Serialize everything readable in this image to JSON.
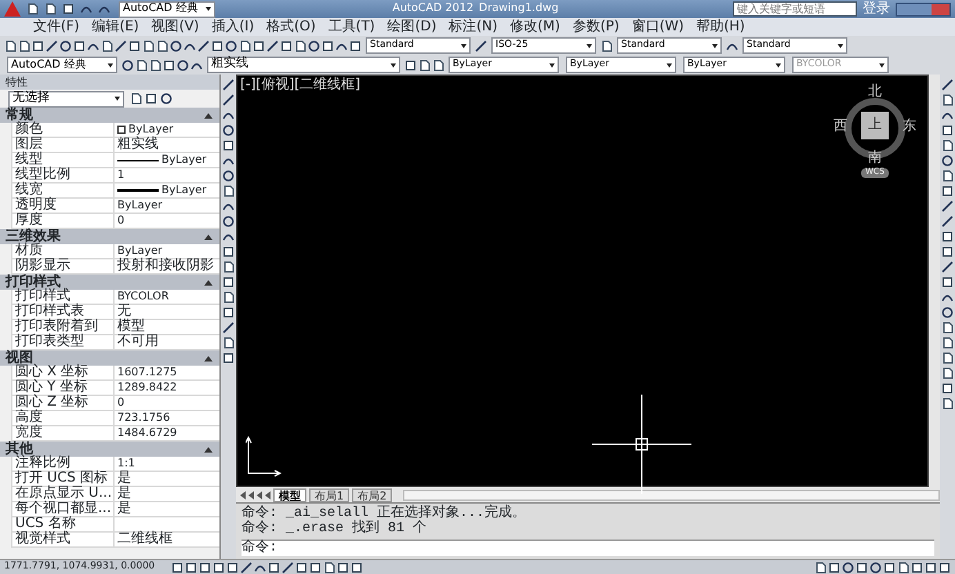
{
  "title_bar": {
    "workspace": "AutoCAD 经典",
    "app": "AutoCAD 2012",
    "file": "Drawing1.dwg",
    "search_placeholder": "键入关键字或短语",
    "login": "登录"
  },
  "menu": [
    "文件(F)",
    "编辑(E)",
    "视图(V)",
    "插入(I)",
    "格式(O)",
    "工具(T)",
    "绘图(D)",
    "标注(N)",
    "修改(M)",
    "参数(P)",
    "窗口(W)",
    "帮助(H)"
  ],
  "styles_toolbar": {
    "text_style": "Standard",
    "dim_style": "ISO-25",
    "table_style": "Standard",
    "mleader_style": "Standard"
  },
  "layers_toolbar": {
    "workspace": "AutoCAD 经典",
    "layer": "粗实线",
    "color_control": "ByLayer",
    "linetype": "ByLayer",
    "lineweight": "ByLayer",
    "plot_style": "BYCOLOR"
  },
  "properties": {
    "title": "特性",
    "selection": "无选择",
    "sections": [
      {
        "title": "常规",
        "expanded": true,
        "rows": [
          {
            "label": "颜色",
            "value": "ByLayer",
            "kind": "color"
          },
          {
            "label": "图层",
            "value": "粗实线",
            "kind": "text"
          },
          {
            "label": "线型",
            "value": "ByLayer",
            "kind": "line"
          },
          {
            "label": "线型比例",
            "value": "1",
            "kind": "text"
          },
          {
            "label": "线宽",
            "value": "ByLayer",
            "kind": "thickline"
          },
          {
            "label": "透明度",
            "value": "ByLayer",
            "kind": "text"
          },
          {
            "label": "厚度",
            "value": "0",
            "kind": "text"
          }
        ]
      },
      {
        "title": "三维效果",
        "expanded": true,
        "rows": [
          {
            "label": "材质",
            "value": "ByLayer",
            "kind": "text"
          },
          {
            "label": "阴影显示",
            "value": "投射和接收阴影",
            "kind": "text"
          }
        ]
      },
      {
        "title": "打印样式",
        "expanded": true,
        "rows": [
          {
            "label": "打印样式",
            "value": "BYCOLOR",
            "kind": "text"
          },
          {
            "label": "打印样式表",
            "value": "无",
            "kind": "text"
          },
          {
            "label": "打印表附着到",
            "value": "模型",
            "kind": "text"
          },
          {
            "label": "打印表类型",
            "value": "不可用",
            "kind": "text"
          }
        ]
      },
      {
        "title": "视图",
        "expanded": true,
        "rows": [
          {
            "label": "圆心 X 坐标",
            "value": "1607.1275",
            "kind": "text"
          },
          {
            "label": "圆心 Y 坐标",
            "value": "1289.8422",
            "kind": "text"
          },
          {
            "label": "圆心 Z 坐标",
            "value": "0",
            "kind": "text"
          },
          {
            "label": "高度",
            "value": "723.1756",
            "kind": "text"
          },
          {
            "label": "宽度",
            "value": "1484.6729",
            "kind": "text"
          }
        ]
      },
      {
        "title": "其他",
        "expanded": true,
        "rows": [
          {
            "label": "注释比例",
            "value": "1:1",
            "kind": "text"
          },
          {
            "label": "打开 UCS 图标",
            "value": "是",
            "kind": "text"
          },
          {
            "label": "在原点显示 U...",
            "value": "是",
            "kind": "text"
          },
          {
            "label": "每个视口都显...",
            "value": "是",
            "kind": "text"
          },
          {
            "label": "UCS 名称",
            "kind": "text"
          },
          {
            "label": "视觉样式",
            "value": "二维线框",
            "kind": "text"
          }
        ]
      }
    ]
  },
  "viewport": {
    "label": "[-][俯视][二维线框]",
    "viewcube": {
      "north": "北",
      "west": "西",
      "face": "上",
      "east": "东",
      "south": "南",
      "wcs": "WCS"
    }
  },
  "layout_tabs": [
    {
      "label": "模型",
      "selected": true
    },
    {
      "label": "布局1",
      "selected": false
    },
    {
      "label": "布局2",
      "selected": false
    }
  ],
  "command_history": [
    "命令: _ai_selall 正在选择对象...完成。",
    "命令: _.erase 找到 81 个"
  ],
  "command_prompt": "命令:",
  "status_bar": {
    "coordinates": "1771.7791, 1074.9931, 0.0000"
  }
}
